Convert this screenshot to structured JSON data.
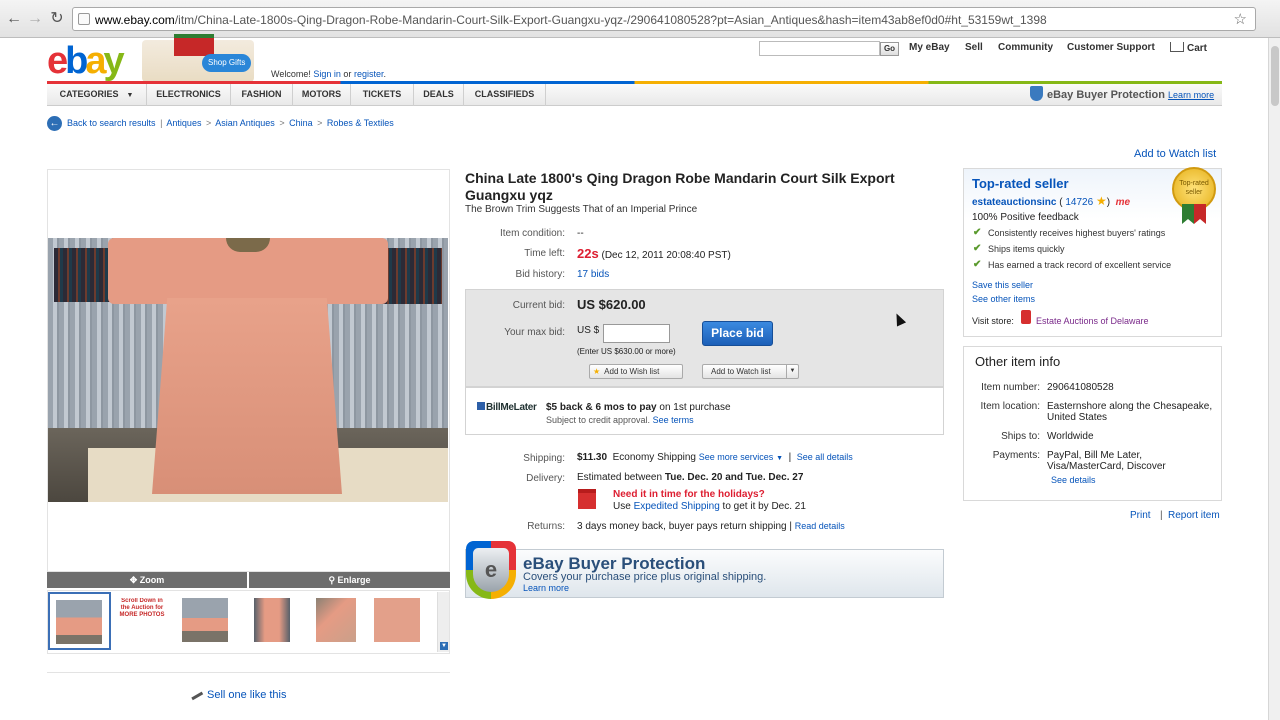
{
  "browser": {
    "url_host": "www.ebay.com",
    "url_rest": "/itm/China-Late-1800s-Qing-Dragon-Robe-Mandarin-Court-Silk-Export-Guangxu-yqz-/290641080528?pt=Asian_Antiques&hash=item43ab8ef0d0#ht_53159wt_1398",
    "icons": [
      "back-icon",
      "forward-icon",
      "reload-icon",
      "bookmark-star-icon"
    ]
  },
  "header": {
    "logo_letters": [
      "e",
      "b",
      "a",
      "y"
    ],
    "promo_label": "Shop Gifts",
    "welcome_prefix": "Welcome!",
    "sign_in": "Sign in",
    "or": "or",
    "register": "register",
    "search_button": "Go",
    "links": {
      "my_ebay": "My eBay",
      "sell": "Sell",
      "community": "Community",
      "support": "Customer Support",
      "cart": "Cart"
    }
  },
  "catnav": {
    "items": [
      "CATEGORIES",
      "ELECTRONICS",
      "FASHION",
      "MOTORS",
      "TICKETS",
      "DEALS",
      "CLASSIFIEDS"
    ],
    "buyer_protection": "eBay Buyer Protection",
    "learn_more": "Learn more"
  },
  "breadcrumb": {
    "back": "Back to search results",
    "sep": "|",
    "path": [
      "Antiques",
      "Asian Antiques",
      "China",
      "Robes & Textiles"
    ],
    "arrow": ">"
  },
  "watch_top": "Add to Watch list",
  "item": {
    "title": "China Late 1800's Qing Dragon Robe Mandarin Court Silk Export Guangxu yqz",
    "subtitle": "The Brown Trim Suggests That of an Imperial Prince",
    "condition_label": "Item condition:",
    "condition_value": "--",
    "time_label": "Time left:",
    "time_value": "22s",
    "time_end": "(Dec 12, 2011 20:08:40 PST)",
    "bids_label": "Bid history:",
    "bids_value": "17 bids",
    "current_bid_label": "Current bid:",
    "current_bid_value": "US $620.00",
    "max_bid_label": "Your max bid:",
    "currency_prefix": "US $",
    "max_bid_value": "",
    "min_hint": "(Enter US $630.00 or more)",
    "place_bid": "Place bid",
    "wish_list": "Add to Wish list",
    "watch_list": "Add to Watch list",
    "bml_logo": "BillMeLater",
    "bml_offer": "$5 back & 6 mos to pay",
    "bml_offer_suffix": "on 1st purchase",
    "bml_note": "Subject to credit approval.",
    "see_terms": "See terms",
    "shipping_label": "Shipping:",
    "shipping_cost": "$11.30",
    "shipping_type": "Economy Shipping",
    "see_more_services": "See more services",
    "see_all_details": "See all details",
    "delivery_label": "Delivery:",
    "delivery_prefix": "Estimated between",
    "delivery_dates": "Tue. Dec. 20 and Tue. Dec. 27",
    "holiday_q": "Need it in time for the holidays?",
    "holiday_use": "Use",
    "expedited": "Expedited Shipping",
    "holiday_suffix": "to get it by Dec. 21",
    "returns_label": "Returns:",
    "returns_value": "3 days money back, buyer pays return shipping",
    "read_details": "Read details",
    "bp_title": "eBay Buyer Protection",
    "bp_sub": "Covers your purchase price plus original shipping.",
    "bp_learn": "Learn more"
  },
  "gallery": {
    "zoom": "Zoom",
    "enlarge": "Enlarge",
    "thumb_text": "Scroll Down in the Auction for MORE PHOTOS",
    "sell_one": "Sell one like this"
  },
  "seller": {
    "heading": "Top-rated seller",
    "name": "estateauctionsinc",
    "score": "14726",
    "me_badge": "me",
    "feedback": "100% Positive feedback",
    "medal_text": "Top-rated seller",
    "points": [
      "Consistently receives highest buyers' ratings",
      "Ships items quickly",
      "Has earned a track record of excellent service"
    ],
    "save_seller": "Save this seller",
    "other_items": "See other items",
    "visit_store": "Visit store:",
    "store_name": "Estate Auctions of Delaware"
  },
  "other_info": {
    "heading": "Other item info",
    "number_label": "Item number:",
    "number": "290641080528",
    "location_label": "Item location:",
    "location": "Easternshore along the Chesapeake, United States",
    "ships_label": "Ships to:",
    "ships": "Worldwide",
    "payments_label": "Payments:",
    "payments": "PayPal, Bill Me Later, Visa/MasterCard, Discover",
    "see_details": "See details"
  },
  "footer_links": {
    "print": "Print",
    "report": "Report item"
  },
  "colors": {
    "link": "#0654ba",
    "time_red": "#dd1e31",
    "place_bid": "#1c5fb8",
    "check_green": "#5a9a2d"
  }
}
